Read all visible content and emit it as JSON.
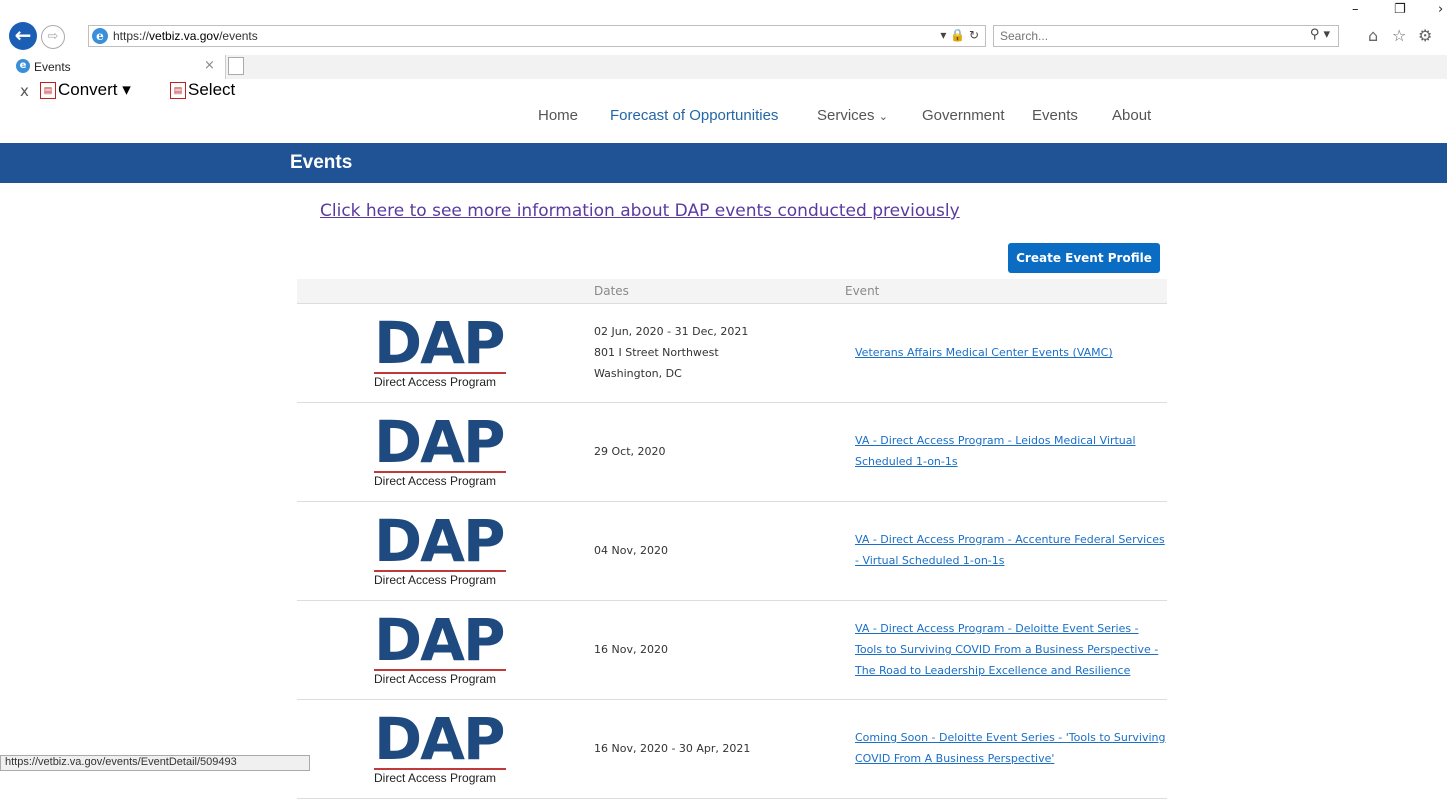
{
  "browser": {
    "url_prefix": "https://",
    "url_host": "vetbiz.va.gov",
    "url_path": "/events",
    "search_placeholder": "Search...",
    "tab_title": "Events",
    "toolbar_convert": "Convert",
    "toolbar_select": "Select",
    "status_url": "https://vetbiz.va.gov/events/EventDetail/509493"
  },
  "nav": {
    "items": [
      "Home",
      "Forecast of Opportunities",
      "Services",
      "Government",
      "Events",
      "About"
    ],
    "services_caret": "⌄"
  },
  "banner": {
    "title": "Events"
  },
  "dap_link": "Click here to see more information about DAP events conducted previously",
  "create_button": "Create Event Profile",
  "table": {
    "headers": {
      "dates": "Dates",
      "event": "Event"
    },
    "logo": {
      "big": "DAP",
      "sub": "Direct Access Program"
    },
    "rows": [
      {
        "date": "02 Jun, 2020 - 31 Dec, 2021",
        "address1": "801 I Street Northwest",
        "address2": "Washington, DC",
        "event": "Veterans Affairs Medical Center Events (VAMC)"
      },
      {
        "date": "29 Oct, 2020",
        "event": "VA - Direct Access Program - Leidos Medical Virtual Scheduled 1-on-1s"
      },
      {
        "date": "04 Nov, 2020",
        "event": "VA - Direct Access Program - Accenture Federal Services - Virtual Scheduled 1-on-1s"
      },
      {
        "date": "16 Nov, 2020",
        "event": "VA - Direct Access Program - Deloitte Event Series - Tools to Surviving COVID From a Business Perspective - The Road to Leadership Excellence and Resilience"
      },
      {
        "date": "16 Nov, 2020 - 30 Apr, 2021",
        "event": "Coming Soon - Deloitte Event Series - 'Tools to Surviving COVID From A Business Perspective'"
      }
    ]
  }
}
